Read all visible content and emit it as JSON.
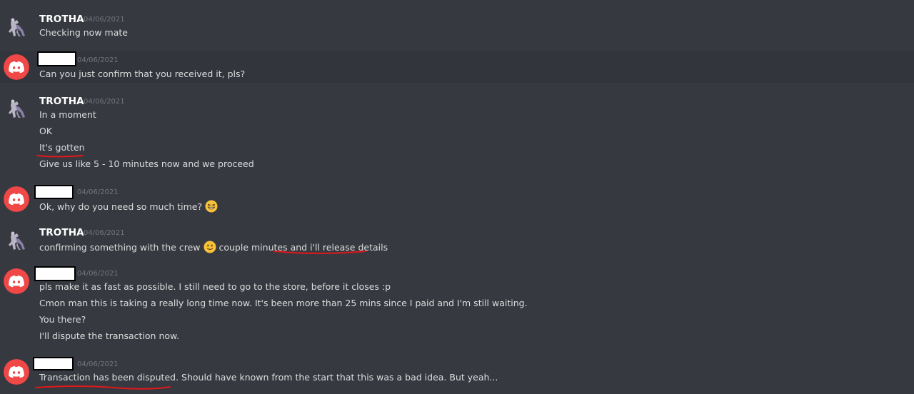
{
  "date": "04/06/2021",
  "users": {
    "trotha": "TROTHA"
  },
  "colors": {
    "background": "#36393f",
    "hover_row": "#32353b",
    "discord_avatar": "#f04747",
    "underline": "#e0181b",
    "timestamp": "#72767d"
  },
  "icons": {
    "trotha_avatar": "mewtwo-avatar-icon",
    "other_avatar": "discord-logo-icon",
    "emoji_grin": "grinning-squinting-face-emoji",
    "emoji_smile": "slightly-smiling-face-emoji"
  },
  "messages": {
    "g1": [
      "Checking now mate"
    ],
    "g2": [
      "Can you just confirm that you received it, pls?"
    ],
    "g3": [
      "In a moment",
      "OK",
      "It's gotten",
      "Give us like 5 - 10 minutes now and we proceed"
    ],
    "g4": [
      "Ok, why do you need so much time?"
    ],
    "g5": {
      "part1": "confirming something with the crew",
      "part2": "couple minutes",
      "part3": "and i'll release details"
    },
    "g6": [
      "pls make it as fast as possible. I still need to go to the store, before it closes :p",
      "Cmon man this is taking a really long time now. It's been more than 25 mins since I paid and I'm still waiting.",
      "You there?",
      "I'll dispute the transaction now."
    ],
    "g7": [
      "Transaction has been disputed. Should have known from the start that this was a bad idea. But yeah..."
    ]
  }
}
